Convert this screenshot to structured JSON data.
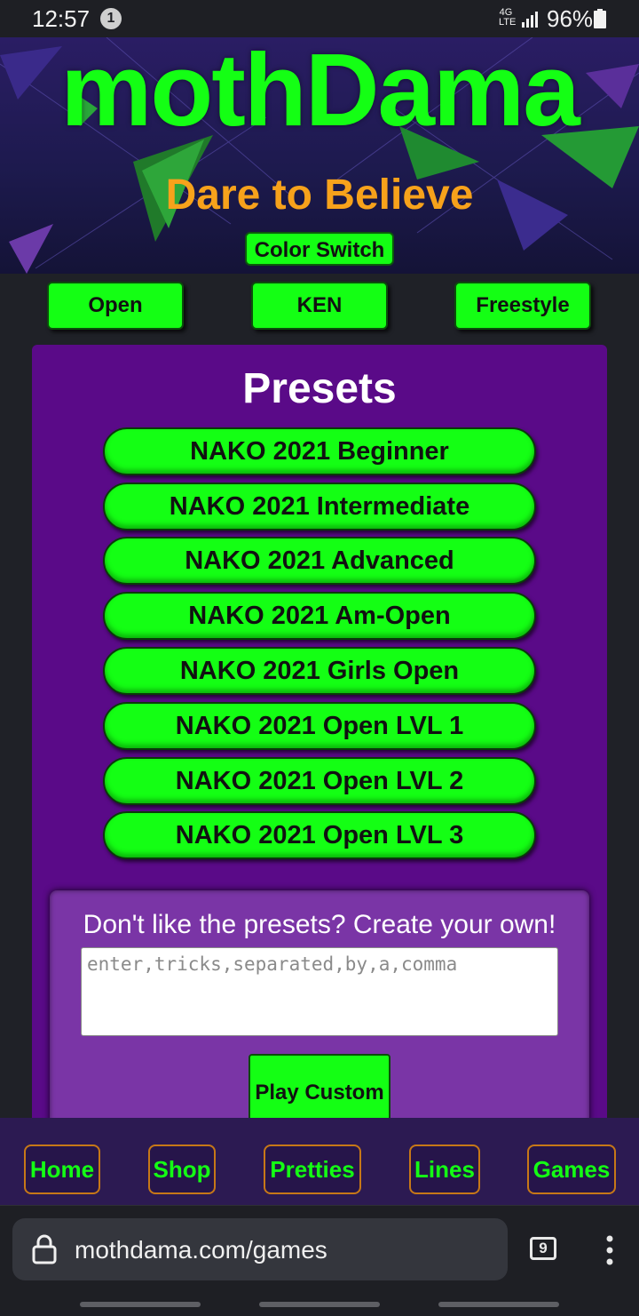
{
  "status_bar": {
    "time": "12:57",
    "notification_count": "1",
    "network_type": "4G LTE",
    "battery": "96%"
  },
  "header": {
    "title": "mothDama",
    "tagline": "Dare to Believe",
    "color_switch_label": "Color Switch"
  },
  "mode_buttons": [
    "Open",
    "KEN",
    "Freestyle"
  ],
  "presets": {
    "title": "Presets",
    "items": [
      "NAKO 2021 Beginner",
      "NAKO 2021 Intermediate",
      "NAKO 2021 Advanced",
      "NAKO 2021 Am-Open",
      "NAKO 2021 Girls Open",
      "NAKO 2021 Open LVL 1",
      "NAKO 2021 Open LVL 2",
      "NAKO 2021 Open LVL 3"
    ]
  },
  "custom": {
    "prompt": "Don't like the presets? Create your own!",
    "placeholder": "enter,tricks,separated,by,a,comma",
    "value": "",
    "play_label": "Play Custom"
  },
  "bottom_nav": [
    "Home",
    "Shop",
    "Pretties",
    "Lines",
    "Games"
  ],
  "browser": {
    "url": "mothdama.com/games",
    "tab_count": "9"
  },
  "colors": {
    "neon_green": "#14ff14",
    "panel_purple": "#5a0a88",
    "tagline_orange": "#f7a21b",
    "nav_border": "#c77817"
  }
}
